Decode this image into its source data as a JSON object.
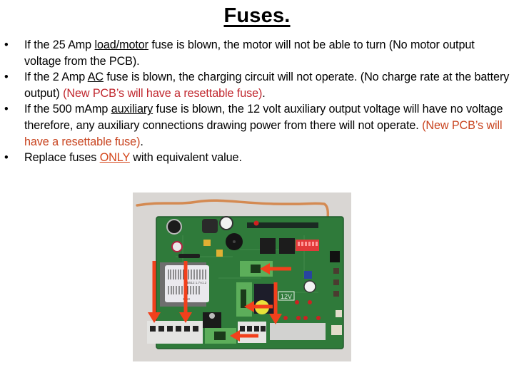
{
  "slide": {
    "title": "Fuses.",
    "bullet_glyph": "•",
    "bullets": [
      {
        "parts": [
          {
            "text": "If the 25 Amp ",
            "style": "normal"
          },
          {
            "text": "load/motor",
            "style": "underline"
          },
          {
            "text": " fuse is blown, the motor will not be able to turn (No motor output voltage from the PCB).",
            "style": "normal"
          }
        ]
      },
      {
        "parts": [
          {
            "text": "If the 2 Amp ",
            "style": "normal"
          },
          {
            "text": "AC",
            "style": "underline"
          },
          {
            "text": " fuse is blown, the charging circuit will not operate. (No charge rate at the battery output) ",
            "style": "normal"
          },
          {
            "text": "(New PCB’s will have a resettable fuse)",
            "style": "red1"
          },
          {
            "text": ".",
            "style": "normal"
          }
        ]
      },
      {
        "parts": [
          {
            "text": "If the 500 mAmp ",
            "style": "normal"
          },
          {
            "text": "auxiliary",
            "style": "underline"
          },
          {
            "text": " fuse is blown, the 12 volt auxiliary output voltage will have no voltage therefore, any auxiliary connections drawing power from there will not operate. ",
            "style": "normal"
          },
          {
            "text": "(New PCB’s will have a resettable fuse)",
            "style": "red2"
          },
          {
            "text": ".",
            "style": "normal"
          }
        ]
      },
      {
        "parts": [
          {
            "text": "Replace fuses ",
            "style": "normal"
          },
          {
            "text": "ONLY",
            "style": "only"
          },
          {
            "text": " with equivalent value.",
            "style": "normal"
          }
        ]
      }
    ]
  },
  "photo": {
    "description": "Control PCB with fuse locations marked by red arrows",
    "label_barcode": "B512 1.7A1.2",
    "label_barcode_2": "1050",
    "label_12v": "12V",
    "colors": {
      "board": "#2f7a3a",
      "arrow": "#f2401c",
      "fuse_holder": "#5cae5a",
      "background": "#d9d6d3"
    }
  }
}
